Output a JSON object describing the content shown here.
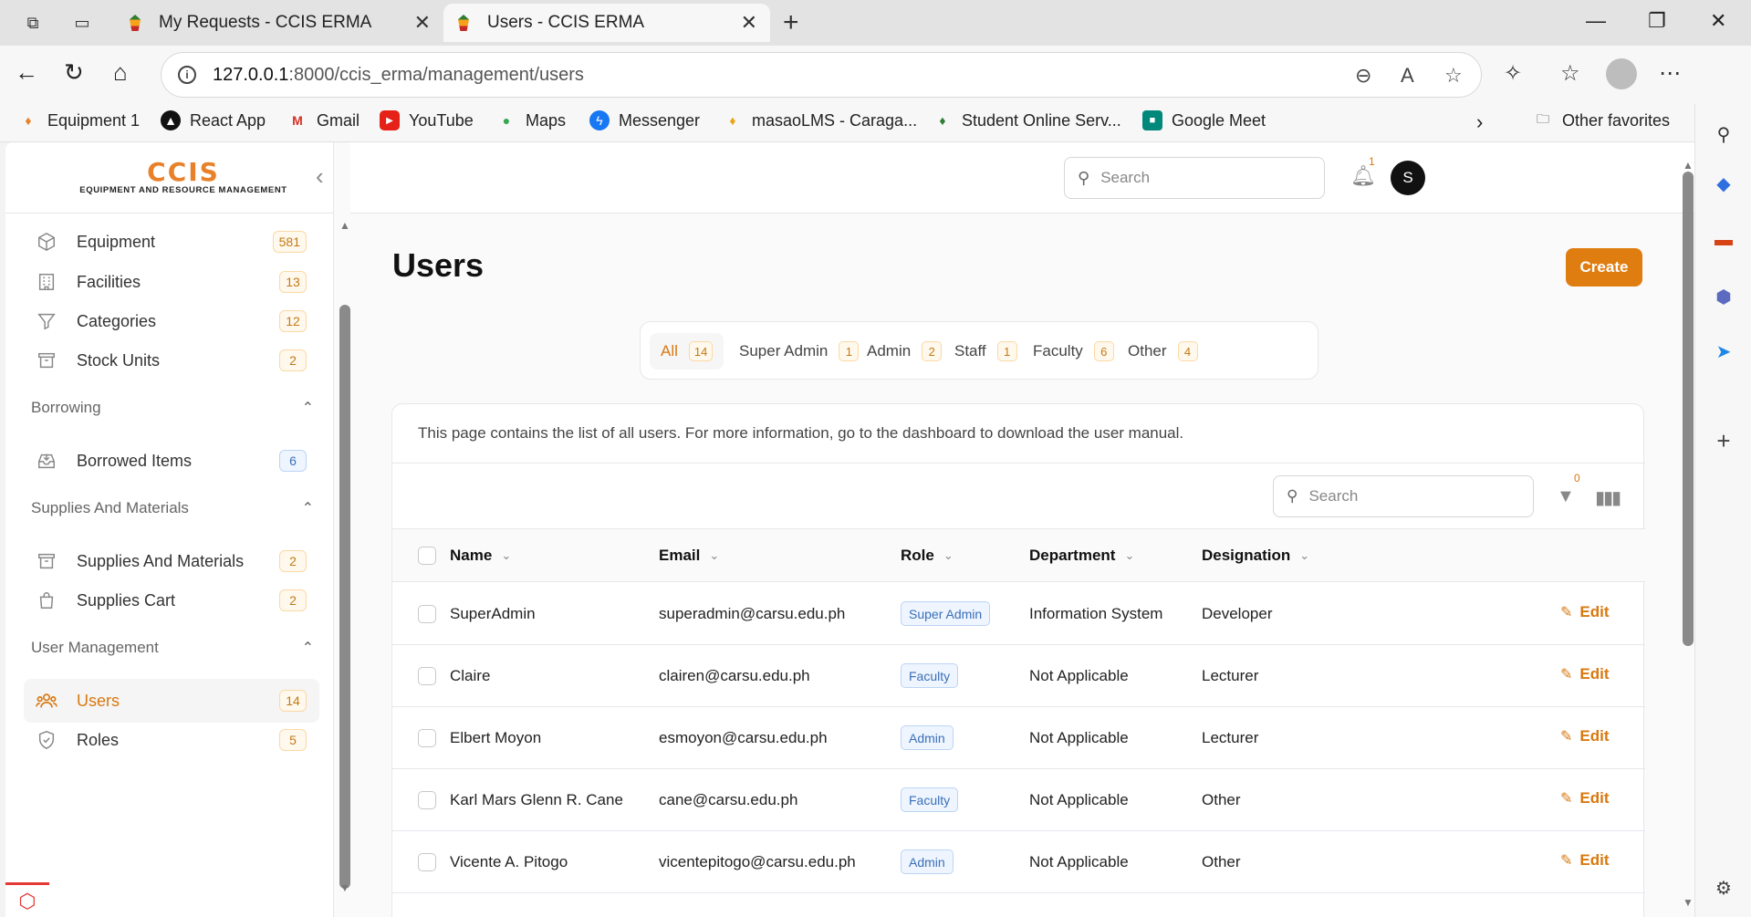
{
  "browser": {
    "tabs": [
      {
        "title": "My Requests - CCIS ERMA",
        "active": false
      },
      {
        "title": "Users - CCIS ERMA",
        "active": true
      }
    ],
    "url_host": "127.0.0.1",
    "url_path": ":8000/ccis_erma/management/users",
    "bookmarks": [
      {
        "label": "Equipment 1",
        "icon": "erma-favicon"
      },
      {
        "label": "React App",
        "icon": "react-icon"
      },
      {
        "label": "Gmail",
        "icon": "gmail-icon"
      },
      {
        "label": "YouTube",
        "icon": "youtube-icon"
      },
      {
        "label": "Maps",
        "icon": "maps-icon"
      },
      {
        "label": "Messenger",
        "icon": "messenger-icon"
      },
      {
        "label": "masaoLMS - Caraga...",
        "icon": "lms-icon"
      },
      {
        "label": "Student Online Serv...",
        "icon": "sos-icon"
      },
      {
        "label": "Google Meet",
        "icon": "meet-icon"
      }
    ],
    "other_favorites": "Other favorites"
  },
  "app": {
    "brand_name": "CCIS",
    "brand_sub": "EQUIPMENT AND RESOURCE MANAGEMENT",
    "top_search_placeholder": "Search",
    "notification_count": "1",
    "avatar_initial": "S",
    "accent": "#e07d10"
  },
  "sidebar": {
    "items": [
      {
        "label": "Equipment",
        "count": "581",
        "icon": "cube-icon"
      },
      {
        "label": "Facilities",
        "count": "13",
        "icon": "building-icon"
      },
      {
        "label": "Categories",
        "count": "12",
        "icon": "funnel-icon"
      },
      {
        "label": "Stock Units",
        "count": "2",
        "icon": "archive-icon"
      }
    ],
    "groups": [
      {
        "label": "Borrowing",
        "items": [
          {
            "label": "Borrowed Items",
            "count": "6",
            "icon": "inbox-icon"
          }
        ]
      },
      {
        "label": "Supplies And Materials",
        "items": [
          {
            "label": "Supplies And Materials",
            "count": "2",
            "icon": "archive-icon"
          },
          {
            "label": "Supplies Cart",
            "count": "2",
            "icon": "shopping-bag-icon"
          }
        ]
      },
      {
        "label": "User Management",
        "items": [
          {
            "label": "Users",
            "count": "14",
            "icon": "users-icon"
          },
          {
            "label": "Roles",
            "count": "5",
            "icon": "shield-icon"
          }
        ]
      }
    ]
  },
  "page": {
    "title": "Users",
    "create_label": "Create",
    "filter_tabs": [
      {
        "label": "All",
        "count": "14"
      },
      {
        "label": "Super Admin",
        "count": "1"
      },
      {
        "label": "Admin",
        "count": "2"
      },
      {
        "label": "Staff",
        "count": "1"
      },
      {
        "label": "Faculty",
        "count": "6"
      },
      {
        "label": "Other",
        "count": "4"
      }
    ],
    "note": "This page contains the list of all users. For more information, go to the dashboard to download the user manual.",
    "table_search_placeholder": "Search",
    "filter_count": "0"
  },
  "table": {
    "columns": [
      "Name",
      "Email",
      "Role",
      "Department",
      "Designation"
    ],
    "edit_label": "Edit",
    "rows": [
      {
        "name": "SuperAdmin",
        "email": "superadmin@carsu.edu.ph",
        "role": "Super Admin",
        "department": "Information System",
        "designation": "Developer"
      },
      {
        "name": "Claire",
        "email": "clairen@carsu.edu.ph",
        "role": "Faculty",
        "department": "Not Applicable",
        "designation": "Lecturer"
      },
      {
        "name": "Elbert Moyon",
        "email": "esmoyon@carsu.edu.ph",
        "role": "Admin",
        "department": "Not Applicable",
        "designation": "Lecturer"
      },
      {
        "name": "Karl Mars Glenn R. Cane",
        "email": "cane@carsu.edu.ph",
        "role": "Faculty",
        "department": "Not Applicable",
        "designation": "Other"
      },
      {
        "name": "Vicente A. Pitogo",
        "email": "vicentepitogo@carsu.edu.ph",
        "role": "Admin",
        "department": "Not Applicable",
        "designation": "Other"
      }
    ]
  }
}
